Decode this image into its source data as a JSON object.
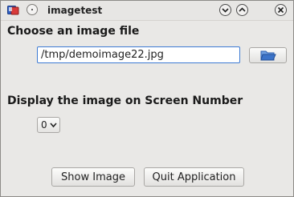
{
  "window": {
    "title": "imagetest"
  },
  "file": {
    "label": "Choose an image file",
    "path": "/tmp/demoimage22.jpg"
  },
  "screen": {
    "label": "Display the image on Screen Number",
    "selected": "0"
  },
  "buttons": {
    "show": "Show Image",
    "quit": "Quit Application"
  },
  "icons": {
    "app": "app-icon",
    "menu": "window-menu-icon",
    "minimize": "chevron-down-icon",
    "maximize": "chevron-up-icon",
    "close": "close-icon",
    "browse": "folder-open-icon",
    "dropdown": "chevron-down-icon"
  },
  "colors": {
    "window_bg": "#e9e8e6",
    "input_focus_border": "#3d7ad3",
    "folder_blue": "#3b73c9"
  }
}
